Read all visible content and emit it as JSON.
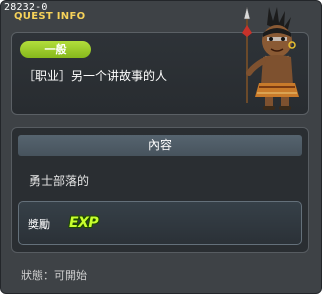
{
  "quest_id": "28232-0",
  "window_title": "QUEST INFO",
  "category": "一般",
  "quest_name": "［职业］另一个讲故事的人",
  "npc_icon": "tribal-warrior-npc-portrait",
  "content_header": "內容",
  "content_text": "勇士部落的",
  "reward_label": "獎勵",
  "reward_icon": "exp-icon",
  "reward_icon_text": "EXP",
  "status_text": "狀態：可開始",
  "colors": {
    "title": "#f6d25a",
    "category_badge": "#9ccc2a",
    "exp": "#c8ff2e"
  }
}
